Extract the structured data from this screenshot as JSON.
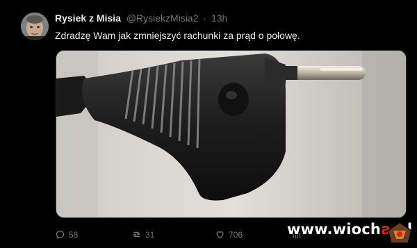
{
  "tweet": {
    "author_name": "Rysiek z Misia",
    "handle": "@RysiekzMisia2",
    "separator": "·",
    "time": "13h",
    "text": "Zdradzę Wam jak zmniejszyć rachunki za prąd o połowę."
  },
  "media": {
    "icon": "electric-plug-photo"
  },
  "actions": {
    "replies": "58",
    "retweets": "31",
    "likes": "706"
  },
  "watermark": {
    "text_main": "www.wioch",
    "text_accent": "a",
    "text_end": ".pl"
  },
  "colors": {
    "background": "#000000",
    "text": "#e7e9ea",
    "muted": "#71767b",
    "watermark_accent": "#d42323"
  }
}
